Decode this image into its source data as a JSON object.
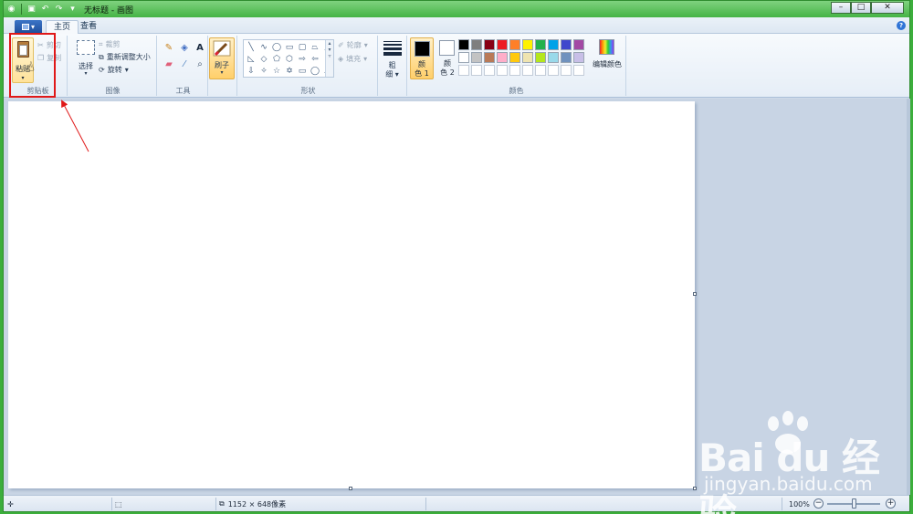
{
  "window": {
    "title": "无标题 - 画图"
  },
  "tabs": [
    {
      "label": "主页",
      "active": true
    },
    {
      "label": "查看",
      "active": false
    }
  ],
  "ribbon": {
    "clipboard": {
      "label": "剪贴板",
      "paste": "粘贴",
      "cut": "剪切",
      "copy": "复制"
    },
    "image": {
      "label": "图像",
      "select": "选择",
      "crop": "裁剪",
      "resize": "重新调整大小",
      "rotate": "旋转"
    },
    "tools": {
      "label": "工具"
    },
    "brushes": {
      "label": "刷子"
    },
    "shapes": {
      "label": "形状",
      "outline": "轮廓",
      "fill": "填充"
    },
    "size": {
      "label_line1": "粗",
      "label_line2": "细"
    },
    "colors": {
      "label": "颜色",
      "color1_line1": "颜",
      "color1_line2": "色 1",
      "color2_line1": "颜",
      "color2_line2": "色 2",
      "edit": "编辑颜色",
      "color1_value": "#000000",
      "color2_value": "#ffffff",
      "palette": [
        "#000000",
        "#7f7f7f",
        "#880015",
        "#ed1c24",
        "#ff7f27",
        "#fff200",
        "#22b14c",
        "#00a2e8",
        "#3f48cc",
        "#a349a4",
        "#ffffff",
        "#c3c3c3",
        "#b97a57",
        "#ffaec9",
        "#ffc90e",
        "#efe4b0",
        "#b5e61d",
        "#99d9ea",
        "#7092be",
        "#c8bfe7",
        "#ffffff",
        "#ffffff",
        "#ffffff",
        "#ffffff",
        "#ffffff",
        "#ffffff",
        "#ffffff",
        "#ffffff",
        "#ffffff",
        "#ffffff"
      ]
    }
  },
  "statusbar": {
    "dimensions": "1152 × 648像素",
    "zoom": "100%"
  },
  "watermark": {
    "brand": "Bai du 经验",
    "url": "jingyan.baidu.com"
  }
}
